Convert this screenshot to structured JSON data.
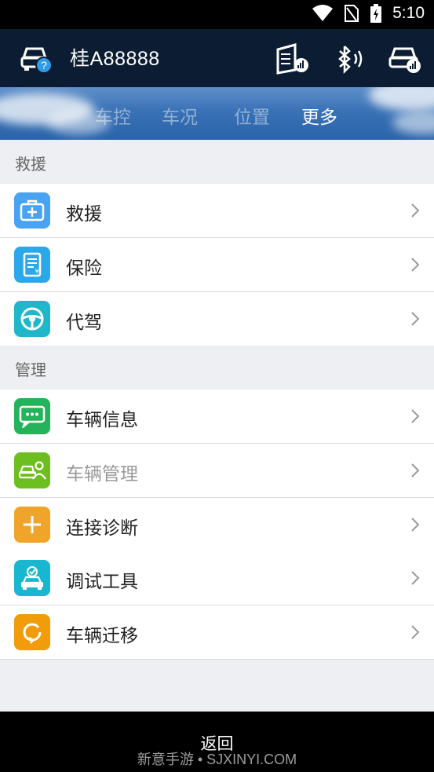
{
  "status_bar": {
    "time": "5:10",
    "icons": [
      "wifi-icon",
      "no-sim-icon",
      "battery-charging-icon"
    ]
  },
  "app_bar": {
    "plate": "桂A88888",
    "left_icon": "car-help-icon",
    "right_icons": [
      "obd-device-icon",
      "bluetooth-icon",
      "car-signal-icon"
    ]
  },
  "tabs": [
    {
      "label": "车控",
      "active": false
    },
    {
      "label": "车况",
      "active": false
    },
    {
      "label": "位置",
      "active": false
    },
    {
      "label": "更多",
      "active": true
    }
  ],
  "sections": [
    {
      "header": "救援",
      "items": [
        {
          "label": "救援",
          "icon": "first-aid-kit-icon",
          "color": "#4aa3f0",
          "enabled": true
        },
        {
          "label": "保险",
          "icon": "insurance-document-icon",
          "color": "#2aa8ea",
          "enabled": true
        },
        {
          "label": "代驾",
          "icon": "steering-wheel-icon",
          "color": "#1fb7c9",
          "enabled": true
        }
      ]
    },
    {
      "header": "管理",
      "items": [
        {
          "label": "车辆信息",
          "icon": "chat-bubble-icon",
          "color": "#22b35b",
          "enabled": true
        },
        {
          "label": "车辆管理",
          "icon": "car-owner-icon",
          "color": "#6cbf1f",
          "enabled": false
        },
        {
          "label": "连接诊断",
          "icon": "plus-icon",
          "color": "#f0a52a",
          "enabled": true
        },
        {
          "label": "调试工具",
          "icon": "car-check-icon",
          "color": "#19b7cf",
          "enabled": true
        },
        {
          "label": "车辆迁移",
          "icon": "refresh-arrow-icon",
          "color": "#f09c0b",
          "enabled": true
        }
      ]
    }
  ],
  "bottom_bar": {
    "back_label": "返回",
    "watermark": "新意手游 • SJXINYI.COM"
  }
}
